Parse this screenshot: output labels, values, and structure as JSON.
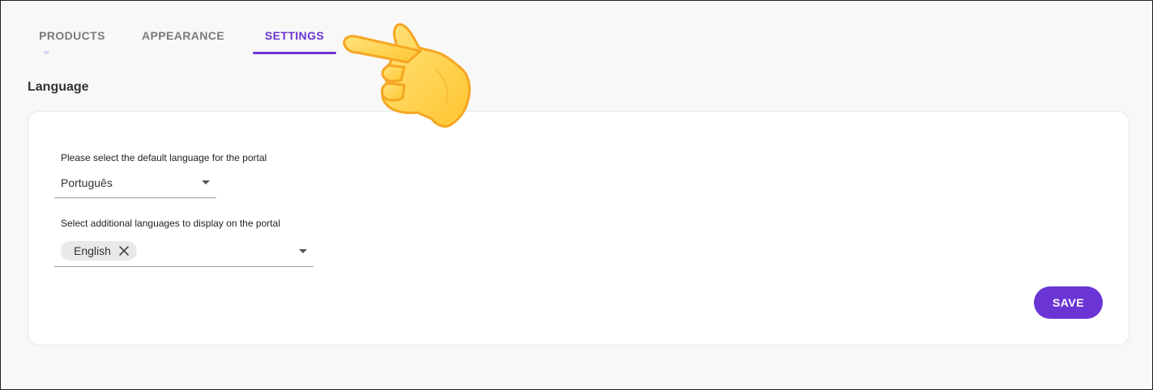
{
  "tabs": [
    {
      "label": "PRODUCTS",
      "active": false
    },
    {
      "label": "APPEARANCE",
      "active": false
    },
    {
      "label": "SETTINGS",
      "active": true
    }
  ],
  "section": {
    "title": "Language"
  },
  "default_language": {
    "label": "Please select the default language for the portal",
    "value": "Português",
    "icon": "arrow-drop-down-icon"
  },
  "additional_languages": {
    "label": "Select additional languages to display on the portal",
    "chips": [
      {
        "label": "English",
        "icon": "close-icon"
      }
    ],
    "icon": "arrow-drop-down-icon"
  },
  "actions": {
    "save_label": "SAVE"
  },
  "overlay": {
    "icon": "pointing-hand-icon"
  },
  "colors": {
    "accent": "#6a35d4",
    "background": "#f8f8f8",
    "card": "#ffffff",
    "tab_inactive": "#7a7a7a",
    "chip": "#e9e9e9"
  }
}
